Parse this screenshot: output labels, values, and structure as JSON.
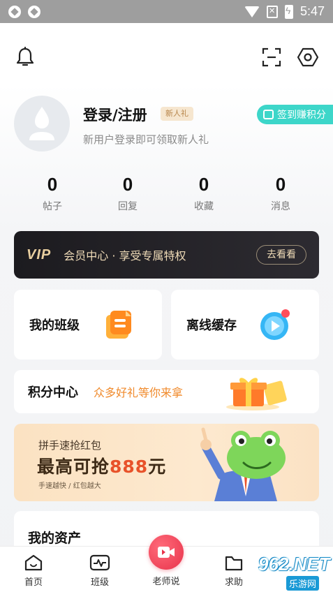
{
  "status_bar": {
    "time": "5:47"
  },
  "profile": {
    "login_title": "登录/注册",
    "newbie_badge": "新人礼",
    "login_subtitle": "新用户登录即可领取新人礼",
    "checkin_label": "签到赚积分"
  },
  "stats": [
    {
      "value": "0",
      "label": "帖子"
    },
    {
      "value": "0",
      "label": "回复"
    },
    {
      "value": "0",
      "label": "收藏"
    },
    {
      "value": "0",
      "label": "消息"
    }
  ],
  "vip": {
    "logo": "VIP",
    "text": "会员中心 · 享受专属特权",
    "button": "去看看"
  },
  "tiles": {
    "my_class": "我的班级",
    "offline_cache": "离线缓存"
  },
  "points": {
    "title": "积分中心",
    "subtitle": "众多好礼等你来拿"
  },
  "redpack": {
    "title": "拼手速抢红包",
    "main_prefix": "最高可抢",
    "amount": "888",
    "main_suffix": "元",
    "small": "手速越快 / 红包越大"
  },
  "assets": {
    "title": "我的资产"
  },
  "tabbar": {
    "home": "首页",
    "class": "班级",
    "teacher": "老师说",
    "help": "求助"
  },
  "watermark": {
    "text": "962.NET",
    "sub": "乐游网"
  },
  "colors": {
    "accent_teal": "#3dd6c9",
    "vip_gold": "#f0dcb8",
    "points_orange": "#f08a2b",
    "redpack_red": "#e8522a",
    "center_button": "#e8334b"
  }
}
